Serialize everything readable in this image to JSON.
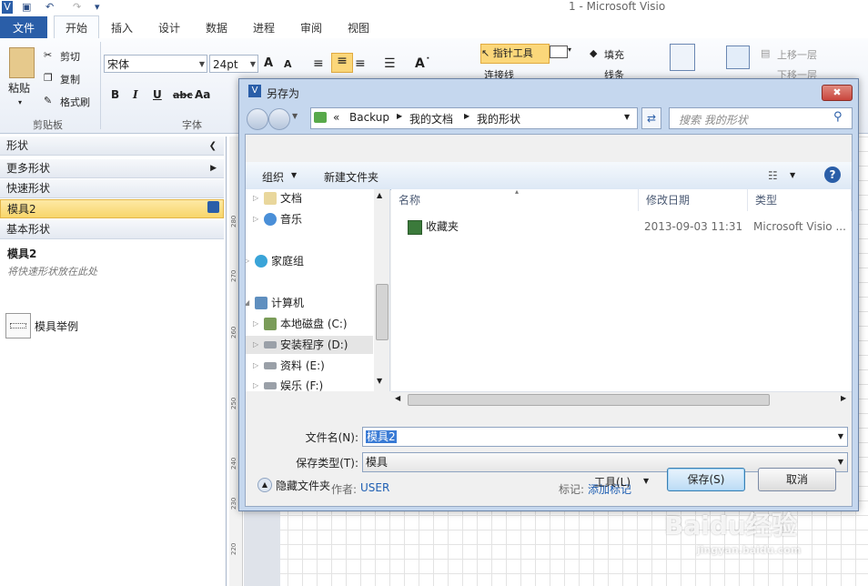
{
  "app": {
    "title": "1 - Microsoft Visio",
    "tabs": [
      "文件",
      "开始",
      "插入",
      "设计",
      "数据",
      "进程",
      "审阅",
      "视图"
    ]
  },
  "ribbon": {
    "clipboard": {
      "paste": "粘贴",
      "cut": "剪切",
      "copy": "复制",
      "format_painter": "格式刷",
      "group_label": "剪贴板"
    },
    "font": {
      "font_name": "宋体",
      "font_size": "24pt",
      "group_label": "字体",
      "bold": "B",
      "italic": "I",
      "underline": "U",
      "strike": "abc",
      "case": "Aa",
      "grow": "A",
      "shrink": "A"
    },
    "tools": {
      "pointer": "指针工具",
      "connector": "连接线",
      "fill": "填充",
      "line": "线条",
      "bring_forward": "上移一层",
      "send_backward": "下移一层"
    }
  },
  "shapes_pane": {
    "header": "形状",
    "more_shapes": "更多形状",
    "quick_shapes": "快速形状",
    "stencil2": "模具2",
    "basic_shapes": "基本形状",
    "stencil_title": "模具2",
    "stencil_hint": "将快速形状放在此处",
    "example": "模具举例"
  },
  "ruler": {
    "ticks": [
      "280",
      "270",
      "260",
      "250",
      "240",
      "230",
      "220"
    ]
  },
  "dialog": {
    "title": "另存为",
    "breadcrumb": [
      "«",
      "Backup",
      "我的文档",
      "我的形状"
    ],
    "search_placeholder": "搜索 我的形状",
    "organize": "组织",
    "new_folder": "新建文件夹",
    "tree": [
      {
        "label": "文档",
        "icon": "documents-icon"
      },
      {
        "label": "音乐",
        "icon": "music-icon"
      },
      {
        "label": "家庭组",
        "icon": "homegroup-icon"
      },
      {
        "label": "计算机",
        "icon": "computer-icon"
      },
      {
        "label": "本地磁盘 (C:)",
        "icon": "disk-icon"
      },
      {
        "label": "安装程序 (D:)",
        "icon": "drive-icon"
      },
      {
        "label": "资料 (E:)",
        "icon": "drive-icon"
      },
      {
        "label": "娱乐 (F:)",
        "icon": "drive-icon"
      }
    ],
    "columns": [
      "名称",
      "修改日期",
      "类型"
    ],
    "files": [
      {
        "name": "收藏夹",
        "date": "2013-09-03 11:31",
        "type": "Microsoft Visio ..."
      }
    ],
    "filename_label": "文件名(N):",
    "filename_value": "模具2",
    "filetype_label": "保存类型(T):",
    "filetype_value": "模具",
    "author_label": "作者:",
    "author_value": "USER",
    "tags_label": "标记:",
    "tags_value": "添加标记",
    "hide_folders": "隐藏文件夹",
    "tools": "工具(L)",
    "save": "保存(S)",
    "cancel": "取消"
  },
  "watermark": {
    "brand": "Baidu经验",
    "url": "jingyan.baidu.com"
  },
  "colors": {
    "file_tab": "#2a5ea8",
    "selected_row": "#f8d66a",
    "dialog_frame": "#c5d7ee",
    "link": "#1f5fb3",
    "close_button": "#c9463d"
  }
}
